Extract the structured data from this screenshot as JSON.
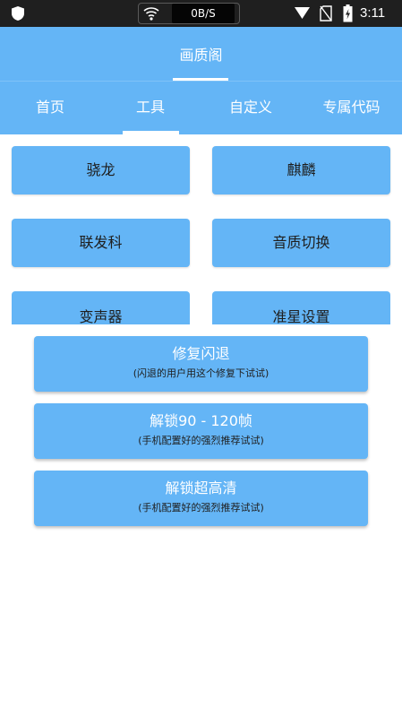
{
  "status_bar": {
    "net_speed": "0B/S",
    "time": "3:11",
    "icons": [
      "shield-icon",
      "wifi-icon",
      "signal-icon",
      "no-sim-icon",
      "battery-charging-icon"
    ]
  },
  "header": {
    "title": "画质阁"
  },
  "tabs": [
    {
      "label": "首页"
    },
    {
      "label": "工具"
    },
    {
      "label": "自定义"
    },
    {
      "label": "专属代码"
    }
  ],
  "active_tab": "工具",
  "grid_buttons": [
    {
      "label": "骁龙"
    },
    {
      "label": "麒麟"
    },
    {
      "label": "联发科"
    },
    {
      "label": "音质切换"
    },
    {
      "label": "变声器"
    },
    {
      "label": "准星设置"
    }
  ],
  "wide_buttons": [
    {
      "label": "修复闪退",
      "sub": "(闪退的用户用这个修复下试试)"
    },
    {
      "label": "解锁90 - 120帧",
      "sub": "(手机配置好的强烈推荐试试)"
    },
    {
      "label": "解锁超高清",
      "sub": "(手机配置好的强烈推荐试试)"
    }
  ],
  "colors": {
    "accent": "#64b5f6",
    "status_bar": "#1f1f1f",
    "button_text_dark": "#1e1e1e",
    "button_text_light": "#ffffff"
  }
}
